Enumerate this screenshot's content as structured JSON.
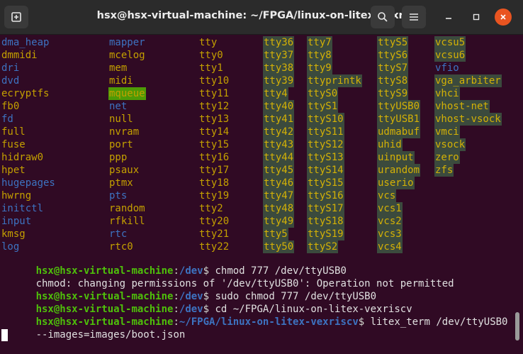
{
  "window": {
    "title": "hsx@hsx-virtual-machine: ~/FPGA/linux-on-litex-vexriscv"
  },
  "icons": {
    "new_tab": "new-tab-icon",
    "search": "search-icon",
    "menu": "hamburger-icon",
    "minimize": "minimize-icon",
    "maximize": "maximize-icon",
    "close": "close-icon"
  },
  "colors": {
    "background": "#300a24",
    "directory": "#3d73c1",
    "device": "#c4a000",
    "sticky_dir_bg": "#4e9a06",
    "prompt_user": "#4ec00a",
    "prompt_path": "#3d73c1",
    "close_button": "#e95420"
  },
  "listing": [
    [
      "dma_heap",
      "mapper",
      "tty",
      "tty36",
      "tty7",
      "ttyS5",
      "vcsu5"
    ],
    [
      "dmmidi",
      "mcelog",
      "tty0",
      "tty37",
      "tty8",
      "ttyS6",
      "vcsu6"
    ],
    [
      "dri",
      "mem",
      "tty1",
      "tty38",
      "tty9",
      "ttyS7",
      "vfio"
    ],
    [
      "dvd",
      "midi",
      "tty10",
      "tty39",
      "ttyprintk",
      "ttyS8",
      "vga_arbiter"
    ],
    [
      "ecryptfs",
      "mqueue",
      "tty11",
      "tty4",
      "ttyS0",
      "ttyS9",
      "vhci"
    ],
    [
      "fb0",
      "net",
      "tty12",
      "tty40",
      "ttyS1",
      "ttyUSB0",
      "vhost-net"
    ],
    [
      "fd",
      "null",
      "tty13",
      "tty41",
      "ttyS10",
      "ttyUSB1",
      "vhost-vsock"
    ],
    [
      "full",
      "nvram",
      "tty14",
      "tty42",
      "ttyS11",
      "udmabuf",
      "vmci"
    ],
    [
      "fuse",
      "port",
      "tty15",
      "tty43",
      "ttyS12",
      "uhid",
      "vsock"
    ],
    [
      "hidraw0",
      "ppp",
      "tty16",
      "tty44",
      "ttyS13",
      "uinput",
      "zero"
    ],
    [
      "hpet",
      "psaux",
      "tty17",
      "tty45",
      "ttyS14",
      "urandom",
      "zfs"
    ],
    [
      "hugepages",
      "ptmx",
      "tty18",
      "tty46",
      "ttyS15",
      "userio",
      ""
    ],
    [
      "hwrng",
      "pts",
      "tty19",
      "tty47",
      "ttyS16",
      "vcs",
      ""
    ],
    [
      "initctl",
      "random",
      "tty2",
      "tty48",
      "ttyS17",
      "vcs1",
      ""
    ],
    [
      "input",
      "rfkill",
      "tty20",
      "tty49",
      "ttyS18",
      "vcs2",
      ""
    ],
    [
      "kmsg",
      "rtc",
      "tty21",
      "tty5",
      "ttyS19",
      "vcs3",
      ""
    ],
    [
      "log",
      "rtc0",
      "tty22",
      "tty50",
      "ttyS2",
      "vcs4",
      ""
    ]
  ],
  "listing_types": [
    [
      "b",
      "b",
      "y",
      "yb",
      "yb",
      "yb",
      "yb"
    ],
    [
      "y",
      "y",
      "y",
      "yb",
      "yb",
      "yb",
      "yb"
    ],
    [
      "b",
      "y",
      "y",
      "yb",
      "yb",
      "yb",
      "b"
    ],
    [
      "b",
      "y",
      "y",
      "yb",
      "yb",
      "yb",
      "yb"
    ],
    [
      "y",
      "g",
      "y",
      "yb",
      "yb",
      "yb",
      "yb"
    ],
    [
      "y",
      "b",
      "y",
      "yb",
      "yb",
      "yb",
      "yb"
    ],
    [
      "b",
      "y",
      "y",
      "yb",
      "yb",
      "yb",
      "yb"
    ],
    [
      "y",
      "y",
      "y",
      "yb",
      "yb",
      "yb",
      "yb"
    ],
    [
      "y",
      "y",
      "y",
      "yb",
      "yb",
      "yb",
      "yb"
    ],
    [
      "y",
      "y",
      "y",
      "yb",
      "yb",
      "yb",
      "yb"
    ],
    [
      "y",
      "y",
      "y",
      "yb",
      "yb",
      "yb",
      "yb"
    ],
    [
      "b",
      "y",
      "y",
      "yb",
      "yb",
      "yb",
      ""
    ],
    [
      "y",
      "b",
      "y",
      "yb",
      "yb",
      "yb",
      ""
    ],
    [
      "b",
      "y",
      "y",
      "yb",
      "yb",
      "yb",
      ""
    ],
    [
      "b",
      "y",
      "y",
      "yb",
      "yb",
      "yb",
      ""
    ],
    [
      "y",
      "b",
      "y",
      "yb",
      "yb",
      "yb",
      ""
    ],
    [
      "b",
      "y",
      "y",
      "yb",
      "yb",
      "yb",
      ""
    ]
  ],
  "history": [
    {
      "user": "hsx@hsx-virtual-machine",
      "sep": ":",
      "path": "/dev",
      "sigil": "$ ",
      "cmd": "chmod 777 /dev/ttyUSB0"
    },
    {
      "text": "chmod: changing permissions of '/dev/ttyUSB0': Operation not permitted"
    },
    {
      "user": "hsx@hsx-virtual-machine",
      "sep": ":",
      "path": "/dev",
      "sigil": "$ ",
      "cmd": "sudo chmod 777 /dev/ttyUSB0"
    },
    {
      "user": "hsx@hsx-virtual-machine",
      "sep": ":",
      "path": "/dev",
      "sigil": "$ ",
      "cmd": "cd ~/FPGA/linux-on-litex-vexriscv"
    },
    {
      "user": "hsx@hsx-virtual-machine",
      "sep": ":",
      "path": "~/FPGA/linux-on-litex-vexriscv",
      "sigil": "$ ",
      "cmd": "litex_term /dev/ttyUSB0"
    },
    {
      "text": "--images=images/boot.json"
    }
  ]
}
